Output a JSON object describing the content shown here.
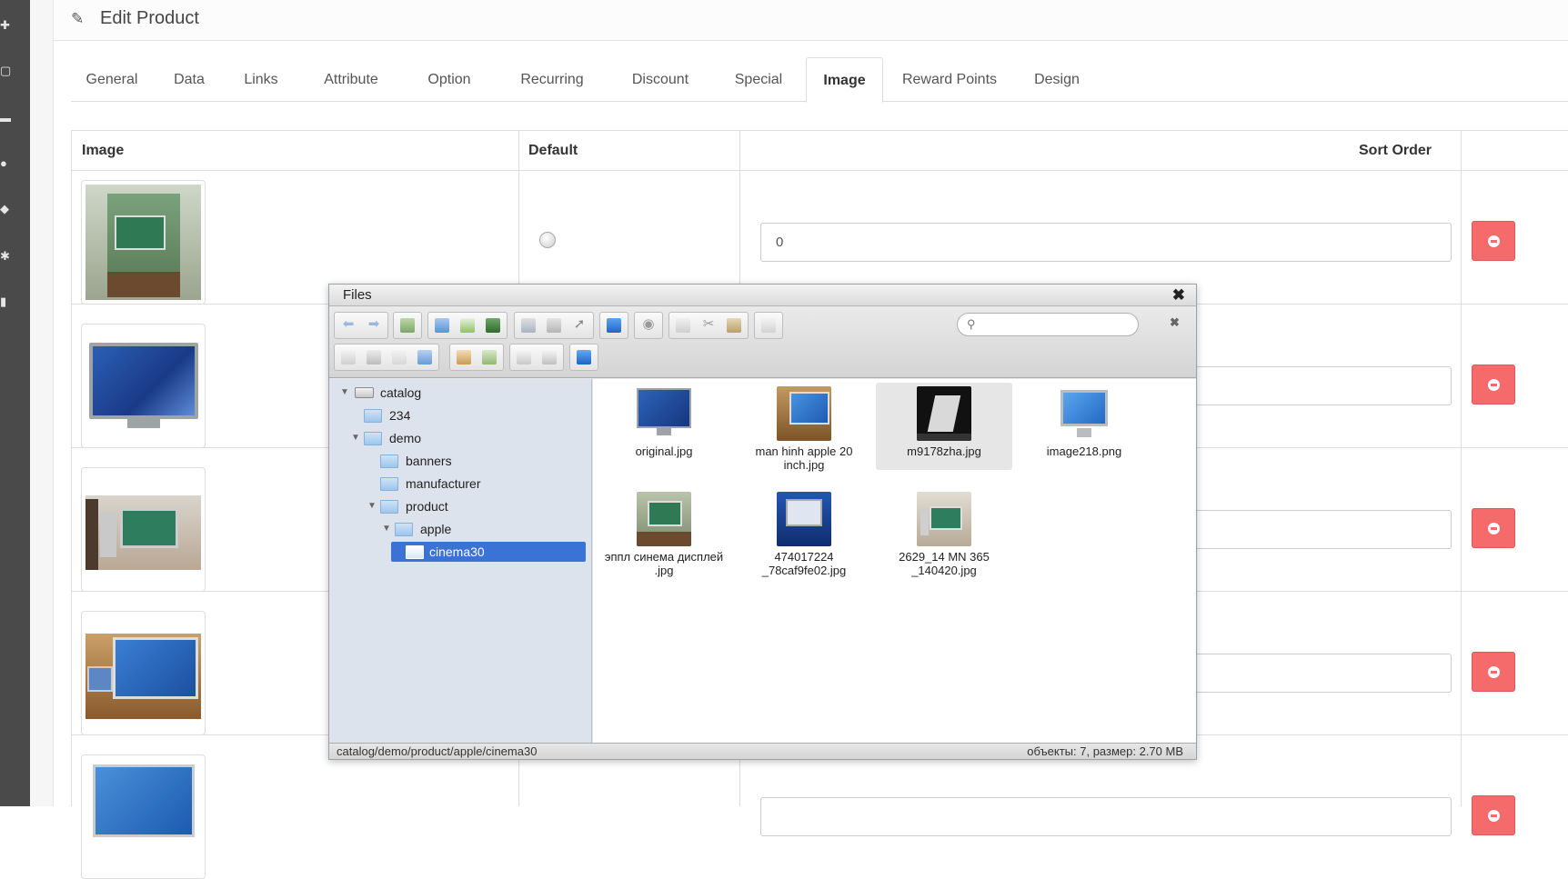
{
  "page": {
    "title": "Edit Product"
  },
  "tabs": [
    {
      "label": "General"
    },
    {
      "label": "Data"
    },
    {
      "label": "Links"
    },
    {
      "label": "Attribute"
    },
    {
      "label": "Option"
    },
    {
      "label": "Recurring"
    },
    {
      "label": "Discount"
    },
    {
      "label": "Special"
    },
    {
      "label": "Image",
      "active": true
    },
    {
      "label": "Reward Points"
    },
    {
      "label": "Design"
    }
  ],
  "image_table": {
    "headers": {
      "image": "Image",
      "default": "Default",
      "sort_order": "Sort Order"
    },
    "rows": [
      {
        "sort_order": "0",
        "default_radio": true
      },
      {
        "sort_order": ""
      },
      {
        "sort_order": ""
      },
      {
        "sort_order": ""
      },
      {
        "sort_order": ""
      }
    ]
  },
  "files_dialog": {
    "title": "Files",
    "tree": [
      {
        "label": "catalog",
        "level": 0,
        "expanded": true,
        "kind": "drive"
      },
      {
        "label": "234",
        "level": 1
      },
      {
        "label": "demo",
        "level": 1,
        "expanded": true
      },
      {
        "label": "banners",
        "level": 2
      },
      {
        "label": "manufacturer",
        "level": 2
      },
      {
        "label": "product",
        "level": 2,
        "expanded": true
      },
      {
        "label": "apple",
        "level": 3,
        "expanded": true
      },
      {
        "label": "cinema30",
        "level": 4,
        "selected": true
      }
    ],
    "files": [
      {
        "name": "original.jpg"
      },
      {
        "name": "man hinh apple 20 inch.jpg"
      },
      {
        "name": "m9178zha.jpg",
        "selected": true
      },
      {
        "name": "image218.png"
      },
      {
        "name": "эппл синема дисплей .jpg"
      },
      {
        "name": "474017224 _78caf9fe02.jpg"
      },
      {
        "name": "2629_14 MN 365 _140420.jpg"
      }
    ],
    "status_path": "catalog/demo/product/apple/cinema30",
    "status_info": "объекты: 7, размер: 2.70 MB"
  },
  "icons": {
    "heading": "pencil-icon",
    "search": "magnifier-icon",
    "remove": "minus-circle-icon"
  },
  "colors": {
    "remove_button": "#f56b6b",
    "tree_selected": "#3a72d6",
    "sidebar": "#4a4a4a"
  }
}
